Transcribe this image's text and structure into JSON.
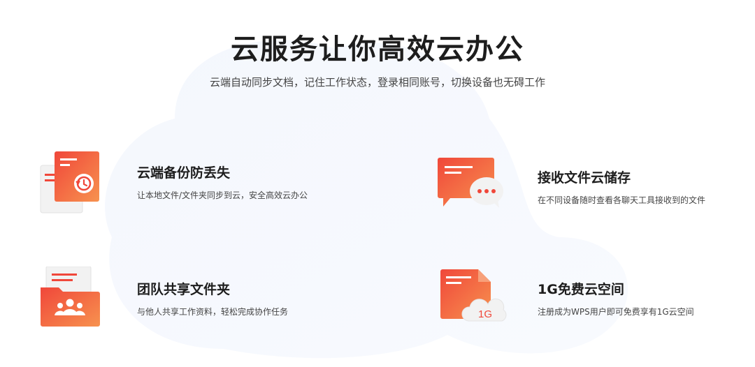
{
  "header": {
    "title": "云服务让你高效云办公",
    "subtitle": "云端自动同步文档，记住工作状态，登录相同账号，切换设备也无碍工作"
  },
  "features": [
    {
      "title": "云端备份防丢失",
      "desc": "让本地文件/文件夹同步到云，安全高效云办公",
      "icon": "backup-restore-icon"
    },
    {
      "title": "接收文件云储存",
      "desc": "在不同设备随时查看各聊天工具接收到的文件",
      "icon": "chat-file-icon"
    },
    {
      "title": "团队共享文件夹",
      "desc": "与他人共享工作资料，轻松完成协作任务",
      "icon": "team-folder-icon"
    },
    {
      "title": "1G免费云空间",
      "desc": "注册成为WPS用户即可免费享有1G云空间",
      "icon": "cloud-storage-icon",
      "badge": "1G"
    }
  ],
  "colors": {
    "accent": "#f0473a",
    "accent_light": "#f7924f",
    "text_dark": "#1d1d1d",
    "text_body": "#444444"
  }
}
